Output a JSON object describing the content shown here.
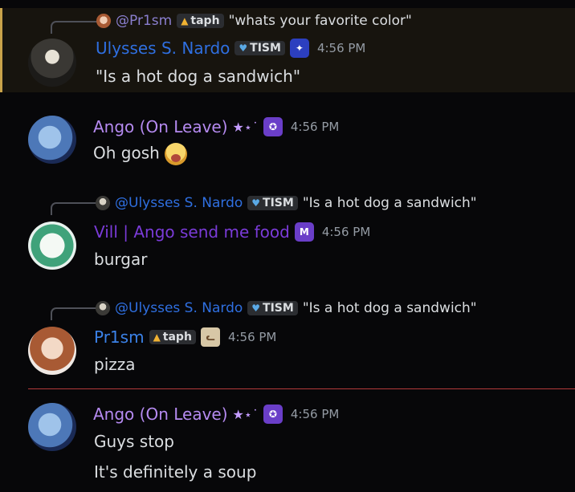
{
  "colors": {
    "ulysses": "#2f6fe0",
    "ango": "#b58af0",
    "vill": "#7a3bd8",
    "prism": "#3b82e8",
    "timestamp": "#949ba4",
    "mention_border": "#c9a34a",
    "divider": "#b33a3a"
  },
  "messages": [
    {
      "reply": {
        "username": "@Pr1sm",
        "tag": "taph",
        "text": "\"whats your favorite color\""
      },
      "username": "Ulysses S. Nardo",
      "tag": "TISM",
      "role_icon": "shield-badge",
      "timestamp": "4:56 PM",
      "content": "\"Is a hot dog a sandwich\""
    },
    {
      "username": "Ango (On Leave)",
      "sparkles": "★⋆˙",
      "role_icon": "medal-badge",
      "timestamp": "4:56 PM",
      "content": "Oh gosh",
      "emoji": "drooling-face-emoji"
    },
    {
      "reply": {
        "username": "@Ulysses S. Nardo",
        "tag": "TISM",
        "text": "\"Is a hot dog a sandwich\""
      },
      "username": "Vill | Ango send me food",
      "role_icon": "M-badge",
      "role_icon_text": "M",
      "timestamp": "4:56 PM",
      "content": "burgar"
    },
    {
      "reply": {
        "username": "@Ulysses S. Nardo",
        "tag": "TISM",
        "text": "\"Is a hot dog a sandwich\""
      },
      "username": "Pr1sm",
      "tag": "taph",
      "role_icon": "cat-badge",
      "timestamp": "4:56 PM",
      "content": "pizza"
    },
    {
      "username": "Ango (On Leave)",
      "sparkles": "★⋆˙",
      "role_icon": "medal-badge",
      "timestamp": "4:56 PM",
      "content": "Guys stop",
      "content2": "It's definitely a soup"
    }
  ]
}
